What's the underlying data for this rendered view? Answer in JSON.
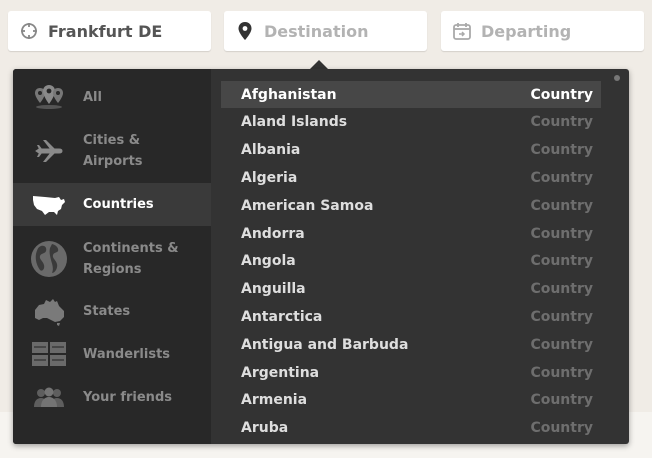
{
  "search": {
    "origin_value": "Frankfurt DE",
    "destination_placeholder": "Destination",
    "departing_placeholder": "Departing"
  },
  "categories": [
    {
      "label": "All",
      "icon": "map-pins-icon",
      "active": false
    },
    {
      "label": "Cities & Airports",
      "icon": "airplane-icon",
      "active": false
    },
    {
      "label": "Countries",
      "icon": "usa-map-icon",
      "active": true
    },
    {
      "label": "Continents & Regions",
      "icon": "globe-icon",
      "active": false
    },
    {
      "label": "States",
      "icon": "australia-map-icon",
      "active": false
    },
    {
      "label": "Wanderlists",
      "icon": "lists-icon",
      "active": false
    },
    {
      "label": "Your friends",
      "icon": "friends-icon",
      "active": false
    }
  ],
  "results": [
    {
      "name": "Afghanistan",
      "type": "Country"
    },
    {
      "name": "Aland Islands",
      "type": "Country"
    },
    {
      "name": "Albania",
      "type": "Country"
    },
    {
      "name": "Algeria",
      "type": "Country"
    },
    {
      "name": "American Samoa",
      "type": "Country"
    },
    {
      "name": "Andorra",
      "type": "Country"
    },
    {
      "name": "Angola",
      "type": "Country"
    },
    {
      "name": "Anguilla",
      "type": "Country"
    },
    {
      "name": "Antarctica",
      "type": "Country"
    },
    {
      "name": "Antigua and Barbuda",
      "type": "Country"
    },
    {
      "name": "Argentina",
      "type": "Country"
    },
    {
      "name": "Armenia",
      "type": "Country"
    },
    {
      "name": "Aruba",
      "type": "Country"
    }
  ],
  "colors": {
    "panel_bg": "#333333",
    "sidebar_bg": "#282828",
    "highlight_bg": "#474747",
    "page_bg": "#f0ece6"
  }
}
